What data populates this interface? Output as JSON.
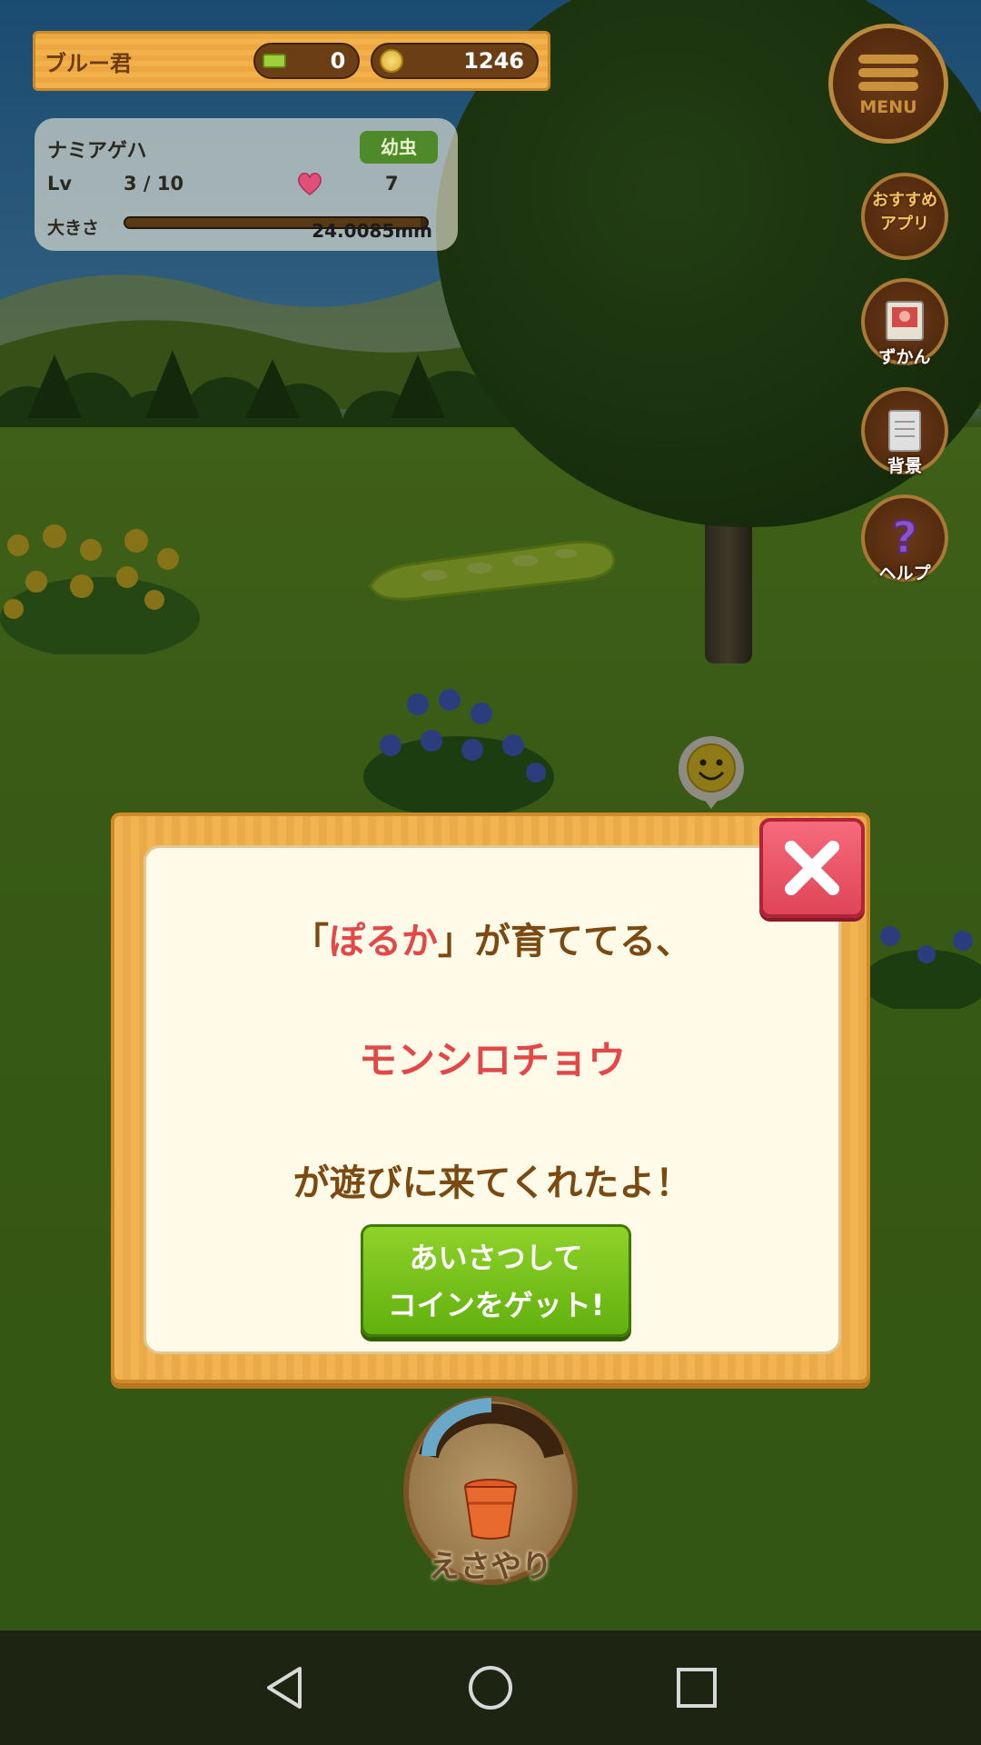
{
  "hud": {
    "player_name": "ブルー君",
    "tickets": "0",
    "coins": "1246"
  },
  "status": {
    "species": "ナミアゲハ",
    "stage": "幼虫",
    "level_label": "Lv",
    "level_value": "3 / 10",
    "love_value": "7",
    "size_label": "大きさ",
    "size_value": "24.0085mm",
    "size_fill_fraction": 0.98
  },
  "side_menu": {
    "menu_label": "MENU",
    "recommend_label": "おすすめ\nアプリ",
    "recommend_line1": "おすすめ",
    "recommend_line2": "アプリ",
    "zukan_label": "ずかん",
    "background_label": "背景",
    "help_label": "ヘルプ"
  },
  "feed": {
    "label": "えさやり",
    "gauge_fraction": 0.3
  },
  "dialog": {
    "line1_open": "「",
    "line1_name": "ぽるか",
    "line1_close": "」が育ててる、",
    "line2": "モンシロチョウ",
    "line3": "が遊びに来てくれたよ！",
    "button_line1": "あいさつして",
    "button_line2": "コインをゲット!"
  },
  "colors": {
    "highlight": "#e24848",
    "text_brown": "#7a4a12",
    "button_green": "#6bb816",
    "close_red": "#e8506a"
  },
  "icons": [
    "menu-icon",
    "ticket-icon",
    "coin-icon",
    "heart-icon",
    "smiley-icon",
    "close-icon",
    "bucket-icon",
    "back-icon",
    "home-icon",
    "recents-icon"
  ]
}
